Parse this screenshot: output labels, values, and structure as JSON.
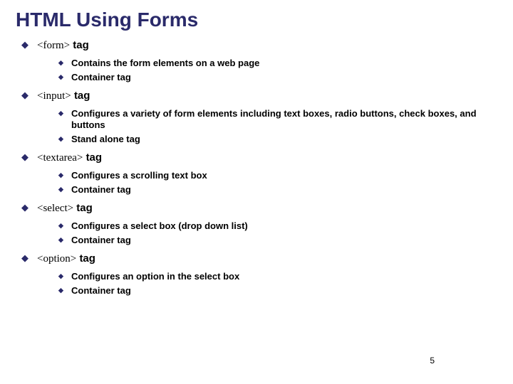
{
  "title": "HTML Using Forms",
  "items": [
    {
      "tag": "<form>",
      "word": "tag",
      "sub": [
        "Contains the form elements on a web page",
        "Container tag"
      ]
    },
    {
      "tag": "<input>",
      "word": "tag",
      "sub": [
        "Configures a variety of form elements including text boxes, radio buttons, check boxes, and buttons",
        "Stand alone tag"
      ]
    },
    {
      "tag": "<textarea>",
      "word": "tag",
      "sub": [
        "Configures a scrolling text box",
        "Container tag"
      ]
    },
    {
      "tag": "<select>",
      "word": "tag",
      "sub": [
        "Configures a select box (drop down list)",
        "Container tag"
      ]
    },
    {
      "tag": "<option>",
      "word": "tag",
      "sub": [
        "Configures an option in the select box",
        "Container tag"
      ]
    }
  ],
  "page_number": "5"
}
